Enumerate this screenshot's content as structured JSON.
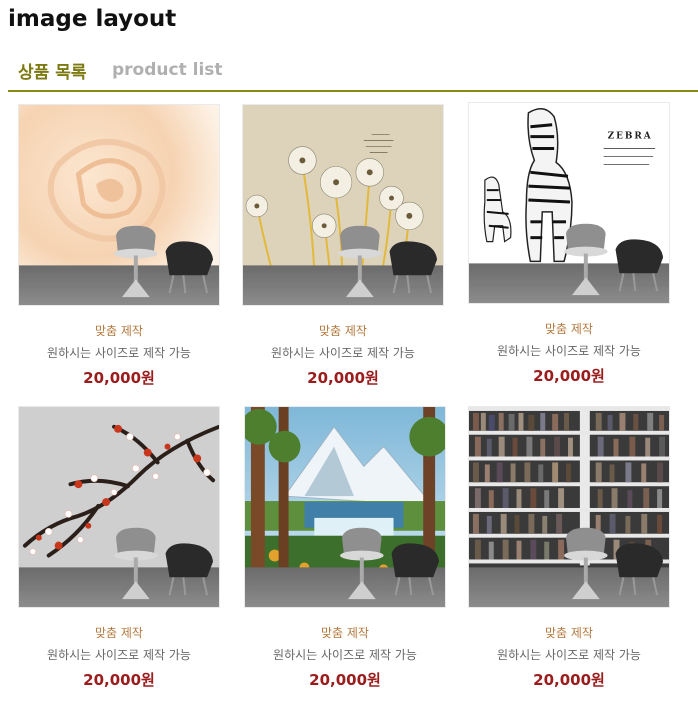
{
  "page": {
    "heading": "image layout"
  },
  "section": {
    "title_ko": "상품 목록",
    "title_en": "product list"
  },
  "accent_color": "#8a8a10",
  "price_color": "#9b1c1c",
  "products": [
    {
      "image": "rose-wallpaper",
      "tag": "맞춤 제작",
      "desc": "원하시는 사이즈로 제작 가능",
      "price": "20,000원"
    },
    {
      "image": "dandelion-wallpaper",
      "tag": "맞춤 제작",
      "desc": "원하시는 사이즈로 제작 가능",
      "price": "20,000원"
    },
    {
      "image": "zebra-wallpaper",
      "tag": "맞춤 제작",
      "desc": "원하시는 사이즈로 제작 가능",
      "price": "20,000원",
      "image_text": "ZEBRA"
    },
    {
      "image": "plum-blossom-wallpaper",
      "tag": "맞춤 제작",
      "desc": "원하시는 사이즈로 제작 가능",
      "price": "20,000원"
    },
    {
      "image": "landscape-painting-wallpaper",
      "tag": "맞춤 제작",
      "desc": "원하시는 사이즈로 제작 가능",
      "price": "20,000원"
    },
    {
      "image": "bookshelf-wallpaper",
      "tag": "맞춤 제작",
      "desc": "원하시는 사이즈로 제작 가능",
      "price": "20,000원"
    }
  ]
}
